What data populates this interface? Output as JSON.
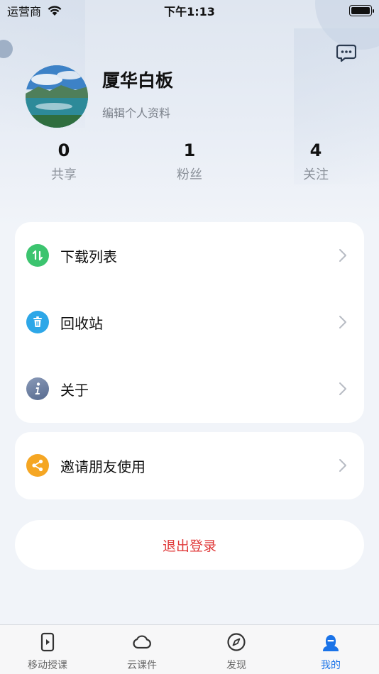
{
  "status_bar": {
    "carrier": "运营商",
    "time": "下午1:13"
  },
  "profile": {
    "name": "厦华白板",
    "edit_label": "编辑个人资料"
  },
  "stats": [
    {
      "value": "0",
      "label": "共享"
    },
    {
      "value": "1",
      "label": "粉丝"
    },
    {
      "value": "4",
      "label": "关注"
    }
  ],
  "menu": {
    "download": {
      "label": "下载列表",
      "icon": "download-list-icon",
      "color": "#3cc46f"
    },
    "recycle": {
      "label": "回收站",
      "icon": "trash-icon",
      "color": "#2da7e8"
    },
    "about": {
      "label": "关于",
      "icon": "info-icon",
      "color": "#6f83a8"
    },
    "invite": {
      "label": "邀请朋友使用",
      "icon": "share-icon",
      "color": "#f5a623"
    }
  },
  "logout_label": "退出登录",
  "tabs": [
    {
      "label": "移动授课",
      "icon": "mobile-teach-icon"
    },
    {
      "label": "云课件",
      "icon": "cloud-icon"
    },
    {
      "label": "发现",
      "icon": "compass-icon"
    },
    {
      "label": "我的",
      "icon": "user-icon",
      "active": true
    }
  ],
  "colors": {
    "accent": "#1a73e8",
    "logout": "#e03a3a"
  }
}
